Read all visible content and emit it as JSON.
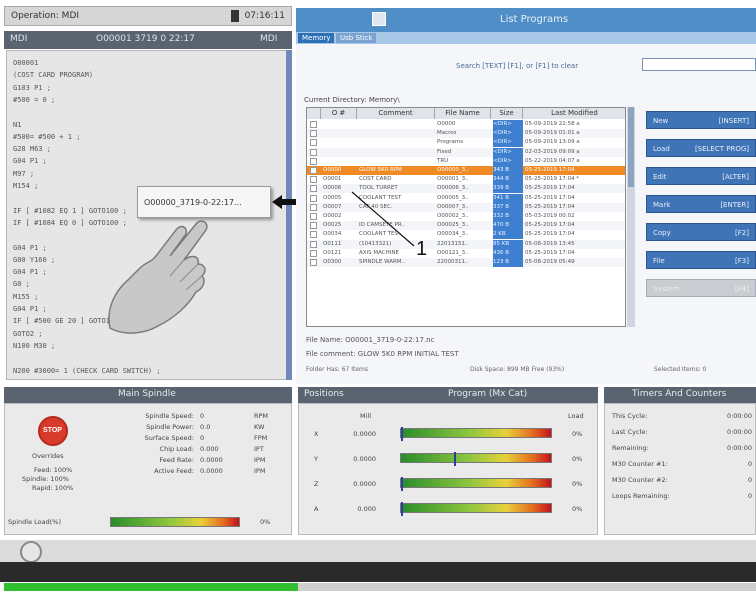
{
  "status_bar": {
    "operation": "Operation: MDI",
    "time": "07:16:11"
  },
  "mdi_header": {
    "mode": "MDI",
    "program": "O00001 3719 0 22:17",
    "tag": "MDI"
  },
  "code_lines": [
    "O00001",
    "(COST CARD PROGRAM)",
    "G103 P1 ;",
    "#500 = 0 ;",
    "",
    "N1",
    "#500= #500 + 1 ;",
    "G28 M63 ;",
    "G04 P1 ;",
    "M97 ;",
    "M154 ;",
    "",
    "IF [ #1082 EQ 1 ] GOTO100 ;",
    "IF [ #1084 EQ 0 ] GOTO100 ;",
    "",
    "G04 P1 ;",
    "G00 Y160 ;",
    "G04 P1 ;",
    "G0 ;",
    "M155 ;",
    "G04 P1 ;",
    "IF [ #500 GE 20 ] GOTO1 ;",
    "GOTO2 ;",
    "N100 M30 ;",
    "",
    "N200 #3000= 1 (CHECK CARD SWITCH) ;"
  ],
  "popup": {
    "text": "O00000_3719-0-22:17..."
  },
  "list_programs": {
    "title": "List Programs",
    "tabs": [
      "Memory",
      "Usb Stick"
    ],
    "search_hint": "Search [TEXT] [F1], or [F1] to clear",
    "search_value": "",
    "current_directory": "Current Directory: Memory\\",
    "columns": [
      "O #",
      "Comment",
      "File Name",
      "Size",
      "Last Modified"
    ],
    "rows": [
      {
        "onum": "",
        "comment": "",
        "file": "O0000",
        "size": "<DIR>",
        "modified": "05-09-2019 22:58 a",
        "sel": false
      },
      {
        "onum": "",
        "comment": "",
        "file": "Macros",
        "size": "<DIR>",
        "modified": "05-09-2019 01:01 a",
        "sel": false
      },
      {
        "onum": "",
        "comment": "",
        "file": "Programs",
        "size": "<DIR>",
        "modified": "05-09-2019 13:09 a",
        "sel": false
      },
      {
        "onum": "",
        "comment": "",
        "file": "Fixed",
        "size": "<DIR>",
        "modified": "02-03-2019 09:09 a",
        "sel": false
      },
      {
        "onum": "",
        "comment": "",
        "file": "TRU",
        "size": "<DIR>",
        "modified": "05-22-2019 04:07 a",
        "sel": false
      },
      {
        "onum": "O0000",
        "comment": "GLOW 5K0 RPM",
        "file": "O00000_3..",
        "size": "343 B",
        "modified": "05-25-2019 17:04",
        "sel": true
      },
      {
        "onum": "O0001",
        "comment": "COST CARD",
        "file": "O00001_3..",
        "size": "344 B",
        "modified": "05-25-2019 17:04 *",
        "sel": false
      },
      {
        "onum": "O0006",
        "comment": "TOOL TURRET",
        "file": "O00006_3..",
        "size": "339 B",
        "modified": "05-25-2019 17:04",
        "sel": false
      },
      {
        "onum": "O0005",
        "comment": "COOLANT TEST",
        "file": "O00005_3..",
        "size": "341 B",
        "modified": "05-25-2019 17:04",
        "sel": false
      },
      {
        "onum": "O0007",
        "comment": "CAT 40 SEC.",
        "file": "O00007_3..",
        "size": "337 B",
        "modified": "05-25-2019 17:04",
        "sel": false
      },
      {
        "onum": "O0002",
        "comment": "",
        "file": "O00002_3..",
        "size": "332 B",
        "modified": "05-03-2019 00:02",
        "sel": false
      },
      {
        "onum": "O0025",
        "comment": "ID CAMSEYE PR..",
        "file": "O00025_3..",
        "size": "470 B",
        "modified": "05-25-2019 17:04",
        "sel": false
      },
      {
        "onum": "O0034",
        "comment": "COOLANT TES..",
        "file": "O00034_3..",
        "size": "2 KB",
        "modified": "05-25-2019 17:04",
        "sel": false
      },
      {
        "onum": "O0111",
        "comment": "(10413321)",
        "file": "22013151..",
        "size": "85 KB",
        "modified": "05-08-2019 13:45",
        "sel": false
      },
      {
        "onum": "O0121",
        "comment": "AXIS MACHINE",
        "file": "O00121_3..",
        "size": "436 B",
        "modified": "05-25-2019 17:04",
        "sel": false
      },
      {
        "onum": "O0300",
        "comment": "SPINDLE WARM..",
        "file": "22000311..",
        "size": "123 B",
        "modified": "05-08-2019 05:49",
        "sel": false
      }
    ],
    "side_buttons": [
      {
        "left": "New",
        "right": "[INSERT]"
      },
      {
        "left": "Load",
        "right": "[SELECT PROG]"
      },
      {
        "left": "Edit",
        "right": "[ALTER]"
      },
      {
        "left": "Mark",
        "right": "[ENTER]"
      },
      {
        "left": "Copy",
        "right": "[F2]"
      },
      {
        "left": "File",
        "right": "[F3]"
      },
      {
        "left": "System",
        "right": "[F4]"
      }
    ],
    "file_name": "File Name: O00001_3719-0-22:17.nc",
    "file_comment": "File comment: GLOW 5K0 RPM INITIAL TEST",
    "footer": {
      "folder": "Folder Has: 67 Items",
      "disk": "Disk Space: 899 MB Free (93%)",
      "selected": "Selected Items: 0"
    }
  },
  "callout": {
    "label": "1"
  },
  "main_spindle": {
    "title": "Main Spindle",
    "stop_label": "STOP",
    "overrides_label": "Overrides",
    "overrides": [
      "Feed: 100%",
      "Spindle: 100%",
      "Rapid: 100%"
    ],
    "readouts": [
      {
        "label": "Spindle Speed:",
        "value": "0",
        "unit": "RPM"
      },
      {
        "label": "Spindle Power:",
        "value": "0.0",
        "unit": "KW"
      },
      {
        "label": "Surface Speed:",
        "value": "0",
        "unit": "FPM"
      },
      {
        "label": "Chip Load:",
        "value": "0.000",
        "unit": "IPT"
      },
      {
        "label": "Feed Rate:",
        "value": "0.0000",
        "unit": "IPM"
      },
      {
        "label": "Active Feed:",
        "value": "0.0000",
        "unit": "IPM"
      }
    ],
    "load_label": "Spindle Load(%)",
    "load_unit": "0%"
  },
  "positions": {
    "title": "Positions",
    "subtitle": "Program (Mx Cat)",
    "col_label": "Mill",
    "col_load": "Load",
    "axes": [
      {
        "axis": "X",
        "value": "0.0000",
        "load": "0%",
        "level": 0.0
      },
      {
        "axis": "Y",
        "value": "0.0000",
        "load": "0%",
        "level": 0.35
      },
      {
        "axis": "Z",
        "value": "0.0000",
        "load": "0%",
        "level": 0.0
      },
      {
        "axis": "A",
        "value": "0.000",
        "load": "0%",
        "level": 0.0
      }
    ]
  },
  "timers": {
    "title": "Timers And Counters",
    "items": [
      {
        "label": "This Cycle:",
        "value": "0:00:00"
      },
      {
        "label": "Last Cycle:",
        "value": "0:00:00"
      },
      {
        "label": "Remaining:",
        "value": "0:00:00"
      },
      {
        "label": "M30 Counter #1:",
        "value": "0"
      },
      {
        "label": "M30 Counter #2:",
        "value": "0"
      },
      {
        "label": "Loops Remaining:",
        "value": "0"
      }
    ]
  },
  "colors": {
    "panel_header": "#5a6470",
    "list_header": "#4f8ec7",
    "selected_row": "#f08a24",
    "accent_button": "#3f74b6"
  }
}
